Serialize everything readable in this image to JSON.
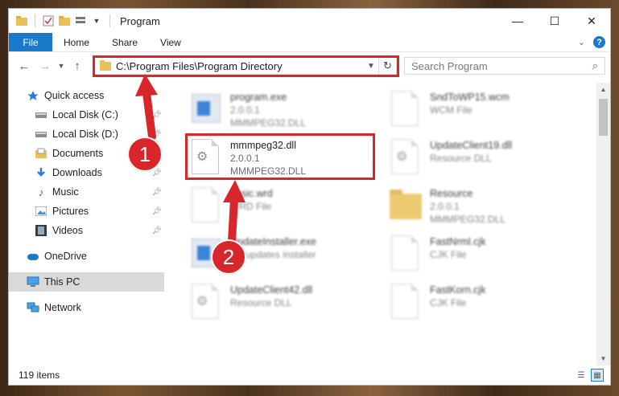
{
  "window": {
    "title": "Program",
    "controls": {
      "minimize": "—",
      "maximize": "☐",
      "close": "✕"
    }
  },
  "ribbon": {
    "tabs": [
      "File",
      "Home",
      "Share",
      "View"
    ]
  },
  "address": {
    "path": "C:\\Program Files\\Program Directory",
    "search_placeholder": "Search Program"
  },
  "navpane": {
    "items": [
      {
        "label": "Quick access",
        "icon": "star-icon",
        "pinned": false
      },
      {
        "label": "Local Disk (C:)",
        "icon": "drive-icon",
        "pinned": true
      },
      {
        "label": "Local Disk (D:)",
        "icon": "drive-icon",
        "pinned": true
      },
      {
        "label": "Documents",
        "icon": "documents-icon",
        "pinned": true
      },
      {
        "label": "Downloads",
        "icon": "download-icon",
        "pinned": true
      },
      {
        "label": "Music",
        "icon": "music-icon",
        "pinned": true
      },
      {
        "label": "Pictures",
        "icon": "pictures-icon",
        "pinned": true
      },
      {
        "label": "Videos",
        "icon": "videos-icon",
        "pinned": true
      },
      {
        "label": "OneDrive",
        "icon": "cloud-icon",
        "pinned": false
      },
      {
        "label": "This PC",
        "icon": "pc-icon",
        "pinned": false,
        "selected": true
      },
      {
        "label": "Network",
        "icon": "network-icon",
        "pinned": false
      }
    ]
  },
  "files": [
    {
      "name": "program.exe",
      "line2": "2.0.0.1",
      "line3": "MMMPEG32.DLL",
      "kind": "exe",
      "blurred": true
    },
    {
      "name": "SndToWP15.wcm",
      "line2": "WCM File",
      "line3": "",
      "kind": "doc",
      "blurred": true
    },
    {
      "name": "mmmpeg32.dll",
      "line2": "2.0.0.1",
      "line3": "MMMPEG32.DLL",
      "kind": "dll",
      "blurred": false
    },
    {
      "name": "UpdateClient19.dll",
      "line2": "Resource DLL",
      "line3": "",
      "kind": "dll",
      "blurred": true
    },
    {
      "name": "basic.wrd",
      "line2": "WRD File",
      "line3": "",
      "kind": "doc",
      "blurred": true
    },
    {
      "name": "Resource",
      "line2": "2.0.0.1",
      "line3": "MMMPEG32.DLL",
      "kind": "folder",
      "blurred": true
    },
    {
      "name": "UpdateInstaller.exe",
      "line2": "BY updates installer",
      "line3": "",
      "kind": "exe",
      "blurred": true
    },
    {
      "name": "FastNrml.cjk",
      "line2": "CJK File",
      "line3": "",
      "kind": "doc",
      "blurred": true
    },
    {
      "name": "UpdateClient42.dll",
      "line2": "Resource DLL",
      "line3": "",
      "kind": "dll",
      "blurred": true
    },
    {
      "name": "FastKorn.cjk",
      "line2": "CJK File",
      "line3": "",
      "kind": "doc",
      "blurred": true
    }
  ],
  "status": {
    "item_count": "119 items"
  },
  "callouts": [
    "1",
    "2"
  ],
  "colors": {
    "accent": "#1979ca",
    "highlight": "#d9262b"
  }
}
